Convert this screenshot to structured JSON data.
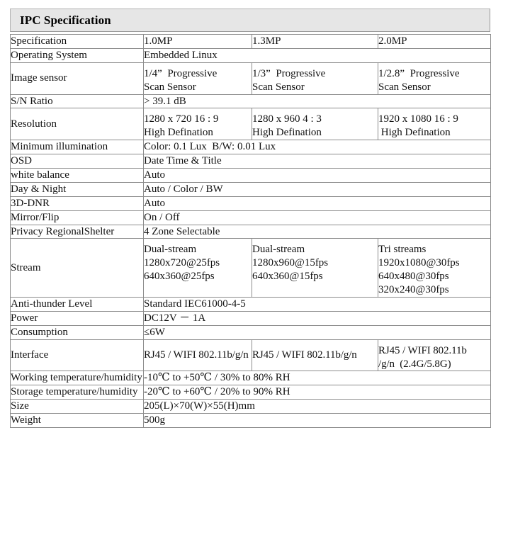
{
  "header": {
    "title": "IPC Specification"
  },
  "table": {
    "columns": [
      "Specification",
      "1.0MP",
      "1.3MP",
      "2.0MP"
    ],
    "rows": [
      {
        "label": "Specification",
        "type": "three",
        "c1": "1.0MP",
        "c2": "1.3MP",
        "c3": "2.0MP"
      },
      {
        "label": "Operating System",
        "type": "span",
        "value": "Embedded Linux"
      },
      {
        "label": "Image sensor",
        "type": "three",
        "c1": "1/4”  Progressive\nScan Sensor",
        "c2": "1/3”  Progressive\nScan Sensor",
        "c3": "1/2.8”  Progressive\nScan Sensor"
      },
      {
        "label": "S/N Ratio",
        "type": "span",
        "value": "> 39.1 dB"
      },
      {
        "label": "Resolution",
        "type": "three",
        "c1": "1280 x 720 16 : 9\nHigh Defination",
        "c2": "1280 x 960 4 : 3\nHigh Defination",
        "c3": "1920 x 1080 16 : 9\n High Defination"
      },
      {
        "label": "Minimum illumination",
        "type": "span",
        "value": "Color: 0.1 Lux  B/W: 0.01 Lux"
      },
      {
        "label": "OSD",
        "type": "span",
        "value": "Date Time & Title"
      },
      {
        "label": "white balance",
        "type": "span",
        "value": "Auto"
      },
      {
        "label": "Day & Night",
        "type": "span",
        "value": "Auto / Color / BW"
      },
      {
        "label": "3D-DNR",
        "type": "span",
        "value": "Auto"
      },
      {
        "label": "Mirror/Flip",
        "type": "span",
        "value": "On / Off"
      },
      {
        "label": "Privacy Regional\nShelter",
        "type": "span",
        "value": "4 Zone Selectable"
      },
      {
        "label": "Stream",
        "type": "three",
        "c1": "Dual-stream\n1280x720@25fps\n640x360@25fps",
        "c2": "Dual-stream\n1280x960@15fps\n640x360@15fps",
        "c3": "Tri streams\n1920x1080@30fps\n640x480@30fps\n320x240@30fps"
      },
      {
        "label": "Anti-thunder Level",
        "type": "span",
        "value": "Standard IEC61000-4-5"
      },
      {
        "label": "Power",
        "type": "span",
        "value": "DC12V － 1A"
      },
      {
        "label": "Consumption",
        "type": "span",
        "value": "≤6W"
      },
      {
        "label": "Interface",
        "type": "three",
        "small": true,
        "c1": "RJ45 / WIFI 802.11b/g/n",
        "c2": "RJ45 / WIFI 802.11b/g/n",
        "c3": "RJ45 / WIFI 802.11b\n/g/n  (2.4G/5.8G)"
      },
      {
        "label": "Working temperature\n/humidity",
        "type": "span",
        "value": "-10℃ to +50℃ / 30% to 80% RH"
      },
      {
        "label": "Storage temperature\n/humidity",
        "type": "span",
        "value": "-20℃ to +60℃ / 20% to 90% RH"
      },
      {
        "label": "Size",
        "type": "span",
        "value": "205(L)×70(W)×55(H)mm"
      },
      {
        "label": "Weight",
        "type": "span",
        "value": "500g"
      }
    ]
  }
}
